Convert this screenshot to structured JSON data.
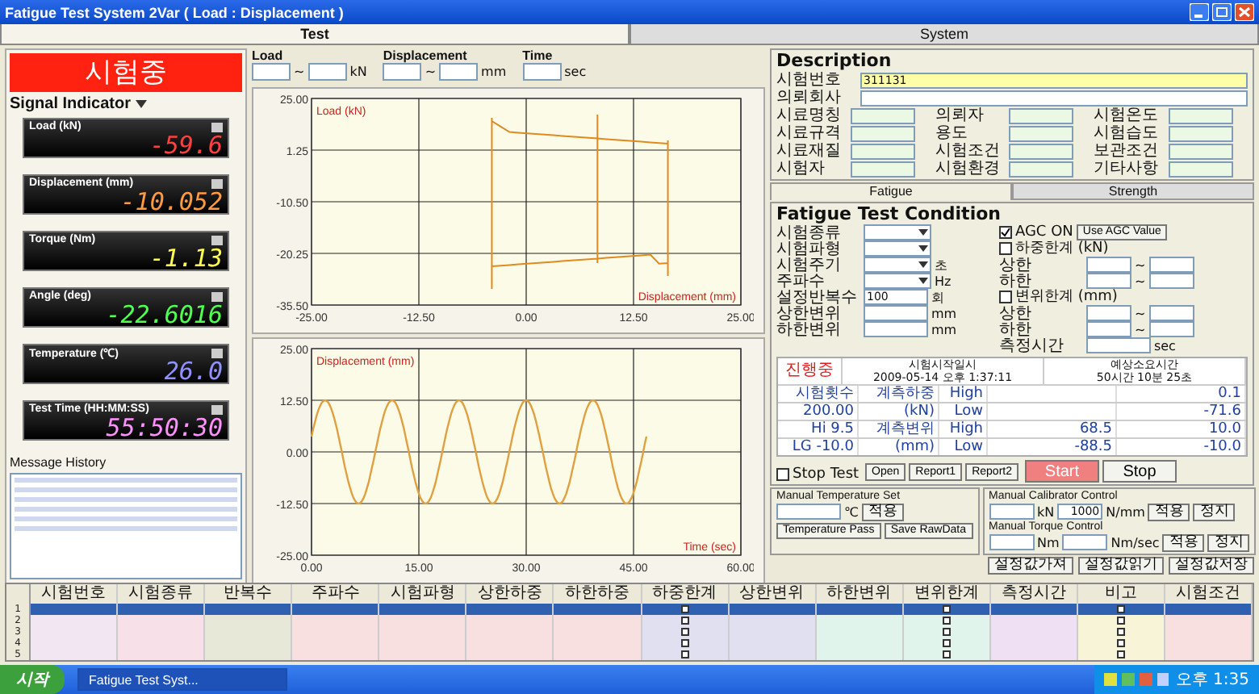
{
  "window": {
    "title": "Fatigue Test System 2Var ( Load : Displacement )"
  },
  "tabs": [
    {
      "label": "Test",
      "selected": true
    },
    {
      "label": "System",
      "selected": false
    }
  ],
  "status_banner": "시험중",
  "signal_indicator": {
    "title": "Signal Indicator",
    "channels": [
      {
        "label": "Load (kN)",
        "value": "-59.6",
        "color": "#ff4040"
      },
      {
        "label": "Displacement (mm)",
        "value": "-10.052",
        "color": "#ff9a40"
      },
      {
        "label": "Torque (Nm)",
        "value": "-1.13",
        "color": "#ffff50"
      },
      {
        "label": "Angle (deg)",
        "value": "-22.6016",
        "color": "#50ff50"
      },
      {
        "label": "Temperature (℃)",
        "value": "26.0",
        "color": "#9090ff"
      },
      {
        "label": "Test Time (HH:MM:SS)",
        "value": "55:50:30",
        "color": "#ff90ff"
      }
    ]
  },
  "message_history": {
    "title": "Message History"
  },
  "range_controls": [
    {
      "label": "Load",
      "unit": "kN",
      "kind": "range",
      "separator": "~"
    },
    {
      "label": "Displacement",
      "unit": "mm",
      "kind": "range",
      "separator": "~"
    },
    {
      "label": "Time",
      "unit": "sec",
      "kind": "single"
    }
  ],
  "charts": [
    {
      "kind": "loop",
      "y_label": "Load (kN)",
      "x_label": "Displacement (mm)",
      "yticks": [
        "25.00",
        "1.25",
        "-10.50",
        "-20.25",
        "-35.50"
      ],
      "xticks": [
        "-25.00",
        "-12.50",
        "0.00",
        "12.50",
        "25.00"
      ]
    },
    {
      "kind": "wave",
      "y_label": "Displacement (mm)",
      "x_label": "Time (sec)",
      "yticks": [
        "25.00",
        "12.50",
        "0.00",
        "-12.50",
        "-25.00"
      ],
      "xticks": [
        "0.00",
        "15.00",
        "30.00",
        "45.00",
        "60.00"
      ]
    }
  ],
  "description": {
    "title": "Description",
    "wide_fields": [
      {
        "label": "시험번호",
        "value": "311131",
        "highlight": true
      },
      {
        "label": "의뢰회사",
        "highlight": false
      }
    ],
    "fields": [
      {
        "label": "시료명칭"
      },
      {
        "label": "의뢰자"
      },
      {
        "label": "시험온도"
      },
      {
        "label": "시료규격"
      },
      {
        "label": "용도"
      },
      {
        "label": "시험습도"
      },
      {
        "label": "시료재질"
      },
      {
        "label": "시험조건"
      },
      {
        "label": "보관조건"
      },
      {
        "label": "시험자"
      },
      {
        "label": "시험환경"
      },
      {
        "label": "기타사항"
      }
    ]
  },
  "subtabs": [
    {
      "label": "Fatigue",
      "selected": true
    },
    {
      "label": "Strength",
      "selected": false
    }
  ],
  "fatigue": {
    "title": "Fatigue Test Condition",
    "left_fields": [
      {
        "label": "시험종류",
        "kind": "select"
      },
      {
        "label": "시험파형",
        "kind": "select"
      },
      {
        "label": "시험주기",
        "kind": "select",
        "unit": "초"
      },
      {
        "label": "주파수",
        "kind": "select",
        "unit": "Hz"
      },
      {
        "label": "설정반복수",
        "kind": "input",
        "value": "100",
        "unit": "회"
      },
      {
        "label": "상한변위",
        "kind": "input",
        "unit": "mm"
      },
      {
        "label": "하한변위",
        "kind": "input",
        "unit": "mm"
      }
    ],
    "right_rows": [
      {
        "kind": "check",
        "label": "AGC ON",
        "checked": true,
        "button": "Use AGC Value"
      },
      {
        "kind": "check",
        "label": "하중한계 (kN)",
        "checked": false
      },
      {
        "kind": "range",
        "label": "상한",
        "separator": "~"
      },
      {
        "kind": "range",
        "label": "하한",
        "separator": "~"
      },
      {
        "kind": "check",
        "label": "변위한계 (mm)",
        "checked": false
      },
      {
        "kind": "range",
        "label": "상한",
        "separator": "~"
      },
      {
        "kind": "range",
        "label": "하한",
        "separator": "~"
      },
      {
        "kind": "input",
        "label": "측정시간",
        "unit": "sec"
      }
    ],
    "summary": {
      "status": "진행중",
      "started_label": "시험시작일시",
      "started": "2009-05-14 오후 1:37:11",
      "remaining_label": "예상소요시간",
      "remaining": "50시간 10분 25초"
    },
    "result_rows": [
      [
        "시험횟수",
        "계측하중",
        "High",
        "",
        "0.1"
      ],
      [
        "200.00",
        "(kN)",
        "Low",
        "",
        "-71.6"
      ],
      [
        "Hi 9.5",
        "계측변위",
        "High",
        "68.5",
        "10.0"
      ],
      [
        "LG -10.0",
        "(mm)",
        "Low",
        "-88.5",
        "-10.0"
      ]
    ],
    "stop_test": {
      "label": "Stop Test",
      "checked": false
    },
    "buttons": [
      {
        "label": "Open",
        "kind": "small"
      },
      {
        "label": "Report1",
        "kind": "small"
      },
      {
        "label": "Report2",
        "kind": "small"
      },
      {
        "label": "Start",
        "kind": "start"
      },
      {
        "label": "Stop",
        "kind": "stop"
      }
    ]
  },
  "manual_temperature": {
    "title": "Manual Temperature Set",
    "unit": "℃",
    "apply": "적용",
    "buttons": [
      "Temperature Pass",
      "Save RawData"
    ]
  },
  "manual_calibrator": {
    "title": "Manual Calibrator Control",
    "unit": "kN",
    "rate_value": "1000",
    "rate_unit": "N/mm",
    "apply": "적용",
    "stop": "정지"
  },
  "manual_torque": {
    "title": "Manual Torque Control",
    "unit": "Nm",
    "rate_unit": "Nm/sec",
    "apply": "적용",
    "stop": "정지"
  },
  "setting_buttons": [
    "설정값가져",
    "설정값읽기",
    "설정값저장"
  ],
  "grid": {
    "columns": [
      {
        "label": "시험번호",
        "kind": "text"
      },
      {
        "label": "시험종류",
        "kind": "text"
      },
      {
        "label": "반복수",
        "kind": "text"
      },
      {
        "label": "주파수",
        "kind": "text"
      },
      {
        "label": "시험파형",
        "kind": "text"
      },
      {
        "label": "상한하중",
        "kind": "text"
      },
      {
        "label": "하한하중",
        "kind": "text"
      },
      {
        "label": "하중한계",
        "kind": "check"
      },
      {
        "label": "상한변위",
        "kind": "text"
      },
      {
        "label": "하한변위",
        "kind": "text"
      },
      {
        "label": "변위한계",
        "kind": "check"
      },
      {
        "label": "측정시간",
        "kind": "text"
      },
      {
        "label": "비고",
        "kind": "check"
      },
      {
        "label": "시험조건",
        "kind": "text"
      }
    ],
    "rows": [
      {
        "number": "1",
        "selected": true,
        "checked": false
      },
      {
        "number": "2",
        "selected": false,
        "checked": false
      },
      {
        "number": "3",
        "selected": false,
        "checked": false
      },
      {
        "number": "4",
        "selected": false,
        "checked": false
      },
      {
        "number": "5",
        "selected": false,
        "checked": false
      }
    ]
  },
  "taskbar": {
    "start": "시작",
    "tasks": [
      {
        "label": "Fatigue Test Syst...",
        "selected": true
      }
    ],
    "clock": "오후 1:35"
  }
}
